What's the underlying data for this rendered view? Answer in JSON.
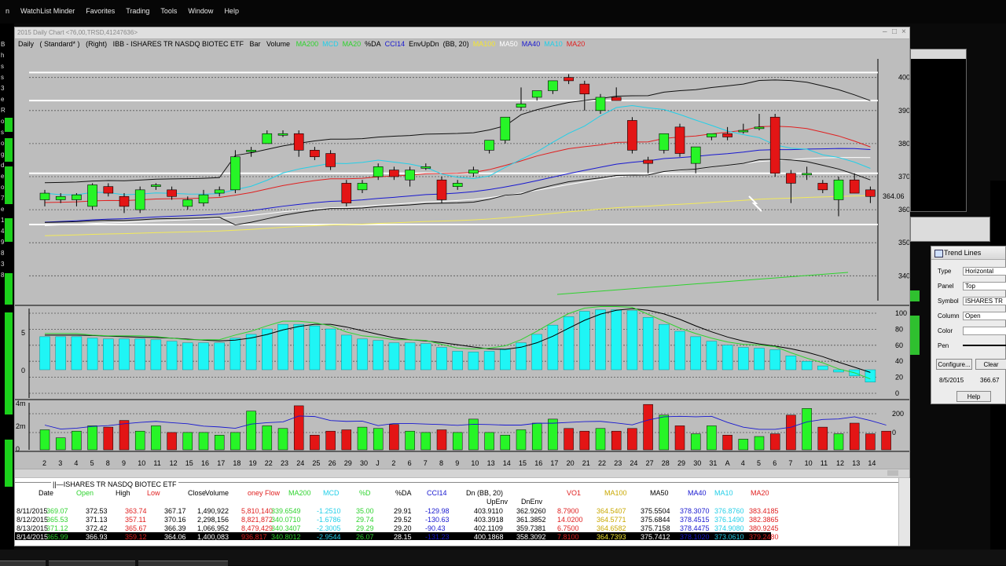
{
  "menu": {
    "items": [
      "n",
      "WatchList Minder",
      "Favorites",
      "Trading",
      "Tools",
      "Window",
      "Help"
    ]
  },
  "left_strip": {
    "labels": [
      "B",
      "h",
      "s",
      "s",
      "3",
      "e",
      "R",
      "o",
      "s",
      "o",
      "g",
      "d",
      "e",
      "o",
      "7",
      "e",
      "1",
      "4",
      "9",
      "8",
      "3",
      "8"
    ]
  },
  "window": {
    "title": "2015 Daily Chart <76,00,TRSD,41247636>"
  },
  "chart_header": {
    "period": "Daily",
    "style": "( Standard* )",
    "axis": "(Right)",
    "symbol": "IBB - ISHARES TR NASDQ BIOTEC ETF",
    "type": "Bar",
    "indicators_label": "Volume",
    "studies": [
      {
        "text": "MA200",
        "color": "#2ed32e"
      },
      {
        "text": "MCD",
        "color": "#22cfe8"
      },
      {
        "text": "MA20",
        "color": "#2ed32e"
      },
      {
        "text": "%DA",
        "color": "#000000"
      },
      {
        "text": "CCI14",
        "color": "#1818d0"
      },
      {
        "text": "EnvUpDn",
        "color": "#000000"
      },
      {
        "text": "(BB, 20)",
        "color": "#000000"
      },
      {
        "text": "MA100",
        "color": "#f5e630"
      },
      {
        "text": "MA50",
        "color": "#ffffff"
      },
      {
        "text": "MA40",
        "color": "#1818d0"
      },
      {
        "text": "MA10",
        "color": "#22cfe8"
      },
      {
        "text": "MA20",
        "color": "#e02020"
      }
    ]
  },
  "chart_data": {
    "type": "candlestick",
    "price_axis": {
      "ticks": [
        400,
        390,
        380,
        370,
        360,
        350,
        340
      ],
      "range": [
        332,
        408
      ],
      "last_price_label": "364.06"
    },
    "oscillator_axis": {
      "right_ticks": [
        100,
        80,
        60,
        40,
        20,
        0
      ],
      "left_ticks": [
        "5",
        "0"
      ]
    },
    "volume_axis": {
      "right_ticks": [
        200,
        0
      ],
      "left_ticks": [
        "4m",
        "2m",
        "0"
      ]
    },
    "x_labels": [
      "2",
      "3",
      "4",
      "5",
      "8",
      "9",
      "10",
      "11",
      "12",
      "15",
      "16",
      "17",
      "18",
      "19",
      "22",
      "23",
      "24",
      "25",
      "26",
      "29",
      "30",
      "J",
      "2",
      "6",
      "7",
      "8",
      "9",
      "10",
      "13",
      "14",
      "15",
      "16",
      "17",
      "20",
      "21",
      "22",
      "23",
      "24",
      "27",
      "28",
      "29",
      "30",
      "31",
      "A",
      "4",
      "5",
      "6",
      "7",
      "10",
      "11",
      "12",
      "13",
      "14"
    ],
    "candles": [
      {
        "o": 363,
        "h": 366,
        "l": 361,
        "c": 365
      },
      {
        "o": 363,
        "h": 365,
        "l": 362,
        "c": 364
      },
      {
        "o": 363,
        "h": 365,
        "l": 361,
        "c": 364.5
      },
      {
        "o": 361,
        "h": 368,
        "l": 360,
        "c": 367.5
      },
      {
        "o": 367,
        "h": 368,
        "l": 364,
        "c": 365
      },
      {
        "o": 364,
        "h": 365,
        "l": 359,
        "c": 361
      },
      {
        "o": 360,
        "h": 367,
        "l": 359,
        "c": 366
      },
      {
        "o": 367,
        "h": 368,
        "l": 366,
        "c": 367.5
      },
      {
        "o": 366,
        "h": 367,
        "l": 363,
        "c": 364
      },
      {
        "o": 361,
        "h": 364,
        "l": 360,
        "c": 363
      },
      {
        "o": 362,
        "h": 366,
        "l": 361,
        "c": 364.5
      },
      {
        "o": 365,
        "h": 367,
        "l": 364,
        "c": 366
      },
      {
        "o": 366,
        "h": 378,
        "l": 365,
        "c": 376
      },
      {
        "o": 378,
        "h": 379,
        "l": 376,
        "c": 378
      },
      {
        "o": 380,
        "h": 384,
        "l": 380,
        "c": 383
      },
      {
        "o": 383,
        "h": 384,
        "l": 382,
        "c": 383
      },
      {
        "o": 383,
        "h": 384,
        "l": 376,
        "c": 378
      },
      {
        "o": 378,
        "h": 379,
        "l": 375,
        "c": 376
      },
      {
        "o": 377,
        "h": 378,
        "l": 372,
        "c": 373
      },
      {
        "o": 368,
        "h": 369,
        "l": 361,
        "c": 362
      },
      {
        "o": 366,
        "h": 369,
        "l": 365,
        "c": 368
      },
      {
        "o": 370,
        "h": 374,
        "l": 369,
        "c": 373
      },
      {
        "o": 372,
        "h": 373,
        "l": 369,
        "c": 370
      },
      {
        "o": 369,
        "h": 373,
        "l": 367,
        "c": 372
      },
      {
        "o": 373,
        "h": 374,
        "l": 372,
        "c": 373
      },
      {
        "o": 369,
        "h": 370,
        "l": 362,
        "c": 363
      },
      {
        "o": 367,
        "h": 369,
        "l": 366,
        "c": 368
      },
      {
        "o": 371,
        "h": 373,
        "l": 370,
        "c": 372
      },
      {
        "o": 378,
        "h": 381,
        "l": 377,
        "c": 381
      },
      {
        "o": 381,
        "h": 388,
        "l": 380,
        "c": 388
      },
      {
        "o": 391,
        "h": 397,
        "l": 390,
        "c": 392
      },
      {
        "o": 394,
        "h": 396,
        "l": 393,
        "c": 396
      },
      {
        "o": 396,
        "h": 399,
        "l": 395,
        "c": 399
      },
      {
        "o": 400,
        "h": 401,
        "l": 398,
        "c": 399
      },
      {
        "o": 398,
        "h": 399,
        "l": 390,
        "c": 395
      },
      {
        "o": 390,
        "h": 395,
        "l": 389,
        "c": 394
      },
      {
        "o": 394,
        "h": 397,
        "l": 393,
        "c": 393
      },
      {
        "o": 387,
        "h": 388,
        "l": 377,
        "c": 378
      },
      {
        "o": 375,
        "h": 376,
        "l": 371,
        "c": 374
      },
      {
        "o": 378,
        "h": 383,
        "l": 377,
        "c": 383
      },
      {
        "o": 385,
        "h": 386,
        "l": 376,
        "c": 377
      },
      {
        "o": 374,
        "h": 376,
        "l": 371,
        "c": 379
      },
      {
        "o": 382,
        "h": 383,
        "l": 381,
        "c": 383
      },
      {
        "o": 383,
        "h": 385,
        "l": 381,
        "c": 382
      },
      {
        "o": 384,
        "h": 386,
        "l": 383,
        "c": 384
      },
      {
        "o": 385,
        "h": 389,
        "l": 384,
        "c": 385
      },
      {
        "o": 388,
        "h": 389,
        "l": 370,
        "c": 371
      },
      {
        "o": 371,
        "h": 372,
        "l": 362,
        "c": 368
      },
      {
        "o": 371,
        "h": 373,
        "l": 369,
        "c": 371
      },
      {
        "o": 368,
        "h": 369,
        "l": 365,
        "c": 366
      },
      {
        "o": 363,
        "h": 370,
        "l": 358,
        "c": 369
      },
      {
        "o": 369,
        "h": 371,
        "l": 365,
        "c": 365
      },
      {
        "o": 366,
        "h": 367,
        "l": 362,
        "c": 364
      }
    ],
    "horizontal_lines": [
      401.5,
      393,
      371,
      355.5
    ],
    "macd_bars": [
      4.3,
      4.3,
      4.3,
      4.1,
      4,
      4,
      4,
      3.9,
      3.7,
      3.5,
      3.5,
      3.5,
      4.1,
      4.6,
      5.3,
      5.9,
      5.9,
      5.7,
      5.3,
      4.5,
      4,
      3.8,
      3.5,
      3.5,
      3.4,
      2.9,
      2.4,
      2.3,
      2.4,
      2.7,
      3.5,
      4.6,
      5.8,
      6.9,
      7.6,
      7.8,
      7.8,
      7.7,
      6.8,
      5.9,
      5,
      4.3,
      3.7,
      3.2,
      2.9,
      2.8,
      2.6,
      1.8,
      1.1,
      0.5,
      -0.3,
      -0.8,
      -1.6
    ],
    "volume_bars": [
      1.5,
      0.9,
      1.4,
      1.8,
      1.7,
      2.2,
      1.4,
      1.8,
      1.3,
      1.3,
      1.3,
      1.1,
      1.3,
      2.9,
      1.8,
      1.6,
      3.3,
      1.1,
      1.4,
      1.5,
      1.7,
      1.6,
      1.9,
      1.4,
      1.3,
      1.5,
      1.3,
      2.3,
      1.3,
      1.1,
      1.5,
      2,
      2.3,
      1.6,
      1.4,
      1.6,
      1.4,
      1.6,
      3.4,
      2.6,
      1.8,
      1.2,
      1.8,
      1.1,
      0.8,
      1,
      1.2,
      2.6,
      3.1,
      1.7,
      1.2,
      2,
      1.2,
      1.4
    ]
  },
  "data_table": {
    "title": "ISHARES TR NASDQ BIOTEC ETF",
    "headers": [
      {
        "text": "Date",
        "color": "#000000"
      },
      {
        "text": "Open",
        "color": "#2ed32e"
      },
      {
        "text": "High",
        "color": "#000000"
      },
      {
        "text": "Low",
        "color": "#e02020"
      },
      {
        "text": "Close",
        "color": "#000000"
      },
      {
        "text": "Volume",
        "color": "#000000"
      },
      {
        "text": "oney Flow",
        "color": "#e02020"
      },
      {
        "text": "MA200",
        "color": "#2ed32e"
      },
      {
        "text": "MCD",
        "color": "#22cfe8"
      },
      {
        "text": "%D",
        "color": "#2ed32e"
      },
      {
        "text": "%DA",
        "color": "#000000"
      },
      {
        "text": "CCI14",
        "color": "#1818d0"
      },
      {
        "text": "Dn (BB, 20)",
        "color": "#000000"
      },
      {
        "text": "VO1",
        "color": "#e02020"
      },
      {
        "text": "MA100",
        "color": "#c9a800"
      },
      {
        "text": "MA50",
        "color": "#000000"
      },
      {
        "text": "MA40",
        "color": "#1818d0"
      },
      {
        "text": "MA10",
        "color": "#22cfe8"
      },
      {
        "text": "MA20",
        "color": "#e02020"
      }
    ],
    "subheaders": [
      "UpEnv",
      "DnEnv"
    ],
    "rows": [
      {
        "date": "8/11/2015",
        "open": "369.07",
        "high": "372.53",
        "low": "363.74",
        "close": "367.17",
        "volume": "1,490,922",
        "mf": "5,810,140",
        "ma200": "339.6549",
        "mcd": "-1.2510",
        "pd": "35.00",
        "pda": "29.91",
        "cci": "-129.98",
        "up": "403.9110",
        "dn": "362.9260",
        "vo1": "8.7900",
        "ma100": "364.5407",
        "ma50": "375.5504",
        "ma40": "378.3070",
        "ma10": "376.8760",
        "ma20": "383.4185"
      },
      {
        "date": "8/12/2015",
        "open": "365.53",
        "high": "371.13",
        "low": "357.11",
        "close": "370.16",
        "volume": "2,298,156",
        "mf": "8,821,872",
        "ma200": "340.0710",
        "mcd": "-1.6786",
        "pd": "29.74",
        "pda": "29.52",
        "cci": "-130.63",
        "up": "403.3918",
        "dn": "361.3852",
        "vo1": "14.0200",
        "ma100": "364.5771",
        "ma50": "375.6844",
        "ma40": "378.4515",
        "ma10": "376.1490",
        "ma20": "382.3865"
      },
      {
        "date": "8/13/2015",
        "open": "371.12",
        "high": "372.42",
        "low": "365.67",
        "close": "366.39",
        "volume": "1,066,952",
        "mf": "8,479,429",
        "ma200": "340.3407",
        "mcd": "-2.3005",
        "pd": "29.29",
        "pda": "29.20",
        "cci": "-90.43",
        "up": "402.1109",
        "dn": "359.7381",
        "vo1": "6.7500",
        "ma100": "364.6582",
        "ma50": "375.7158",
        "ma40": "378.4475",
        "ma10": "374.9080",
        "ma20": "380.9245"
      },
      {
        "date": "8/14/2015",
        "open": "365.99",
        "high": "366.93",
        "low": "359.12",
        "close": "364.06",
        "volume": "1,400,083",
        "mf": "936,817",
        "ma200": "340.8012",
        "mcd": "-2.9544",
        "pd": "26.07",
        "pda": "28.15",
        "cci": "-131.23",
        "up": "400.1868",
        "dn": "358.3092",
        "vo1": "7.8100",
        "ma100": "364.7393",
        "ma50": "375.7412",
        "ma40": "378.1020",
        "ma10": "373.0610",
        "ma20": "379.2480"
      }
    ]
  },
  "trend_dialog": {
    "title": "Trend Lines",
    "fields": [
      {
        "label": "Type",
        "value": "Horizontal"
      },
      {
        "label": "Panel",
        "value": "Top"
      },
      {
        "label": "Symbol",
        "value": "ISHARES TR"
      },
      {
        "label": "Column",
        "value": "Open"
      },
      {
        "label": "Color",
        "value": ""
      },
      {
        "label": "Pen",
        "value": ""
      }
    ],
    "configure_label": "Configure...",
    "clear_label": "Clear",
    "date": "8/5/2015",
    "price": "366.67",
    "help_label": "Help"
  }
}
